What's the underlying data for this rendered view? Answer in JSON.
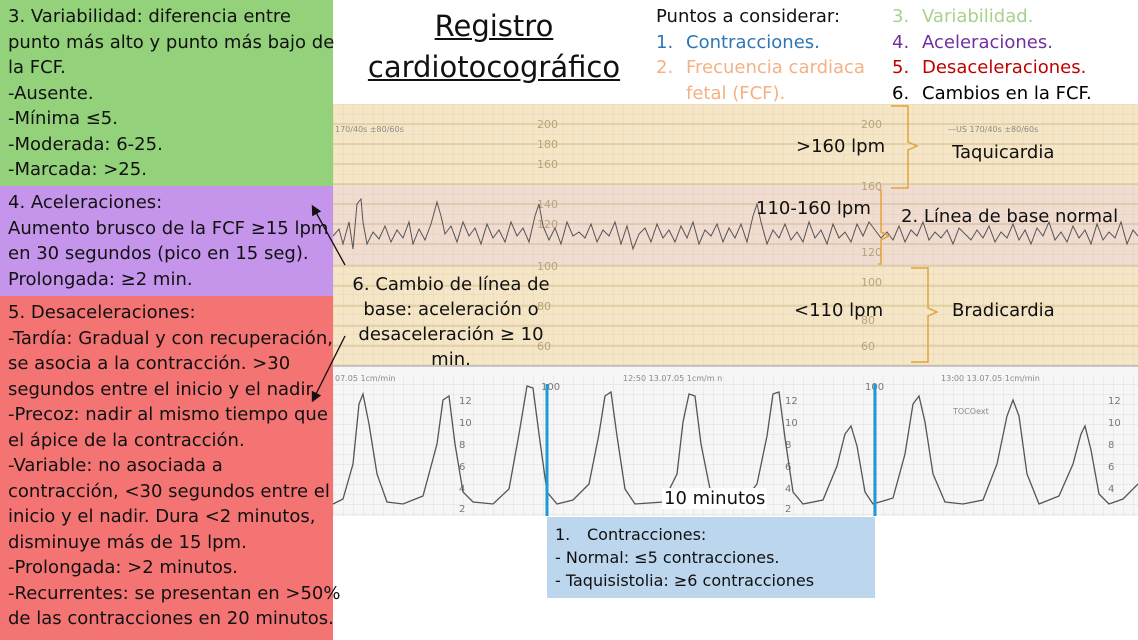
{
  "title": {
    "line1": "Registro",
    "line2": "cardiotocográfico"
  },
  "points": {
    "header": "Puntos a considerar:",
    "items": [
      {
        "num": "1.",
        "text": "Contracciones.",
        "color": "#2e75b6"
      },
      {
        "num": "2.",
        "text": "Frecuencia cardiaca",
        "text2": "fetal (FCF).",
        "color": "#f4b183"
      },
      {
        "num": "3.",
        "text": "Variabilidad.",
        "color": "#a9d18e"
      },
      {
        "num": "4.",
        "text": "Aceleraciones.",
        "color": "#7030a0"
      },
      {
        "num": "5.",
        "text": "Desaceleraciones.",
        "color": "#c00000"
      },
      {
        "num": "6.",
        "text": "Cambios en la FCF.",
        "color": "#000000"
      }
    ]
  },
  "variability": {
    "lines": [
      "3. Variabilidad: diferencia entre",
      "punto más alto y punto más bajo de",
      "la FCF.",
      "-Ausente.",
      "-Mínima ≤5.",
      "-Moderada: 6-25.",
      "-Marcada: >25."
    ],
    "color": "#93d27a"
  },
  "accelerations": {
    "lines": [
      "4. Aceleraciones:",
      "Aumento brusco de la FCF ≥15 lpm",
      "en 30 segundos (pico en 15 seg).",
      "Prolongada: ≥2 min."
    ],
    "color": "#c595ec"
  },
  "decelerations": {
    "lines": [
      "5. Desaceleraciones:",
      "-Tardía: Gradual y con recuperación,",
      "se asocia a la contracción. >30",
      "segundos entre el inicio y el nadir.",
      "-Precoz: nadir al mismo tiempo que",
      "el ápice de la contracción.",
      "-Variable: no asociada a",
      "contracción, <30 segundos entre el",
      "inicio y el nadir. Dura <2 minutos,",
      "disminuye más de 15 lpm.",
      "-Prolongada: >2 minutos.",
      "-Recurrentes: se presentan en >50%",
      "de las contracciones en 20 minutos."
    ],
    "color": "#f47474"
  },
  "baseline_change": {
    "lines": [
      "6. Cambio de línea de",
      "base: aceleración o",
      "desaceleración ≥ 10 min."
    ]
  },
  "fhr_zones": {
    "high": {
      "range": ">160 lpm",
      "label": "Taquicardia"
    },
    "normal": {
      "range": "110-160 lpm",
      "label": "2. Línea de base normal"
    },
    "low": {
      "range": "<110 lpm",
      "label": "Bradicardia"
    }
  },
  "fhr_ticks": [
    "200",
    "180",
    "160",
    "140",
    "120",
    "100",
    "80",
    "60"
  ],
  "toco_ticks": [
    "100",
    "12",
    "10",
    "8",
    "6",
    "4",
    "2"
  ],
  "strip_text": {
    "top_left": "170/40s  ±80/60s",
    "top_right": "—US  170/40s  ±80/60s",
    "mid_left": "07.05  1cm/min",
    "mid_center": "12:50  13.07.05  1cm/m n",
    "mid_right": "13:00  13.07.05  1cm/min",
    "toco": "TOCOext"
  },
  "ten_minutes": "10 minutos",
  "contractions": {
    "title_num": "1.",
    "title": "Contracciones:",
    "normal": "- Normal: ≤5 contracciones.",
    "tachysystole": "- Taquisistolia: ≥6 contracciones",
    "color": "#bcd6ee"
  },
  "colors": {
    "tachy_band": "#f4e6c6",
    "normal_band": "#f1dcd2",
    "brady_band": "#f4e6c6",
    "grid": "#d9c59c",
    "trace": "#555555",
    "bracket": "#e2a33a",
    "marker": "#1f9ad6"
  }
}
